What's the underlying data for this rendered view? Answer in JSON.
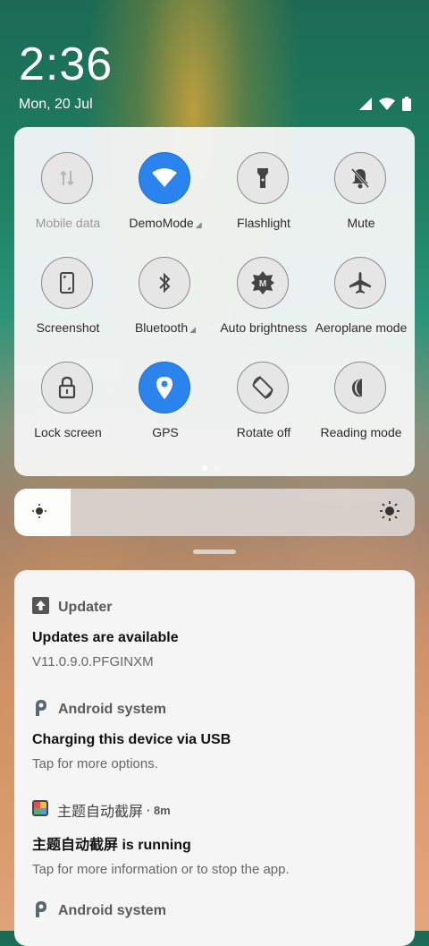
{
  "status": {
    "time": "2:36",
    "date": "Mon, 20 Jul"
  },
  "tiles": [
    {
      "label": "Mobile data",
      "icon": "mobile-data-icon",
      "active": false,
      "disabled": true,
      "arrow": false
    },
    {
      "label": "DemoMode",
      "icon": "wifi-icon",
      "active": true,
      "disabled": false,
      "arrow": true
    },
    {
      "label": "Flashlight",
      "icon": "flashlight-icon",
      "active": false,
      "disabled": false,
      "arrow": false
    },
    {
      "label": "Mute",
      "icon": "bell-off-icon",
      "active": false,
      "disabled": false,
      "arrow": false
    },
    {
      "label": "Screenshot",
      "icon": "screenshot-icon",
      "active": false,
      "disabled": false,
      "arrow": false
    },
    {
      "label": "Bluetooth",
      "icon": "bluetooth-icon",
      "active": false,
      "disabled": false,
      "arrow": true
    },
    {
      "label": "Auto brightness",
      "icon": "auto-brightness-icon",
      "active": false,
      "disabled": false,
      "arrow": false
    },
    {
      "label": "Aeroplane mode",
      "icon": "airplane-icon",
      "active": false,
      "disabled": false,
      "arrow": false
    },
    {
      "label": "Lock screen",
      "icon": "lock-icon",
      "active": false,
      "disabled": false,
      "arrow": false
    },
    {
      "label": "GPS",
      "icon": "location-icon",
      "active": true,
      "disabled": false,
      "arrow": false
    },
    {
      "label": "Rotate off",
      "icon": "rotate-icon",
      "active": false,
      "disabled": false,
      "arrow": false
    },
    {
      "label": "Reading mode",
      "icon": "moon-icon",
      "active": false,
      "disabled": false,
      "arrow": false
    }
  ],
  "brightness": {
    "level_fraction": 0.14
  },
  "notifications": [
    {
      "app": "Updater",
      "icon": "updater-arrow-icon",
      "title": "Updates are available",
      "body": "V11.0.9.0.PFGINXM",
      "time": ""
    },
    {
      "app": "Android system",
      "icon": "android-system-icon",
      "title": "Charging this device via USB",
      "body": "Tap for more options.",
      "time": ""
    },
    {
      "app": "主题自动截屏",
      "icon": "app-icon",
      "title": "主题自动截屏 is running",
      "body": "Tap for more information or to stop the app.",
      "time": "· 8m"
    },
    {
      "app": "Android system",
      "icon": "android-system-icon",
      "title": "",
      "body": "",
      "time": ""
    }
  ],
  "colors": {
    "accent": "#2b83ee"
  }
}
